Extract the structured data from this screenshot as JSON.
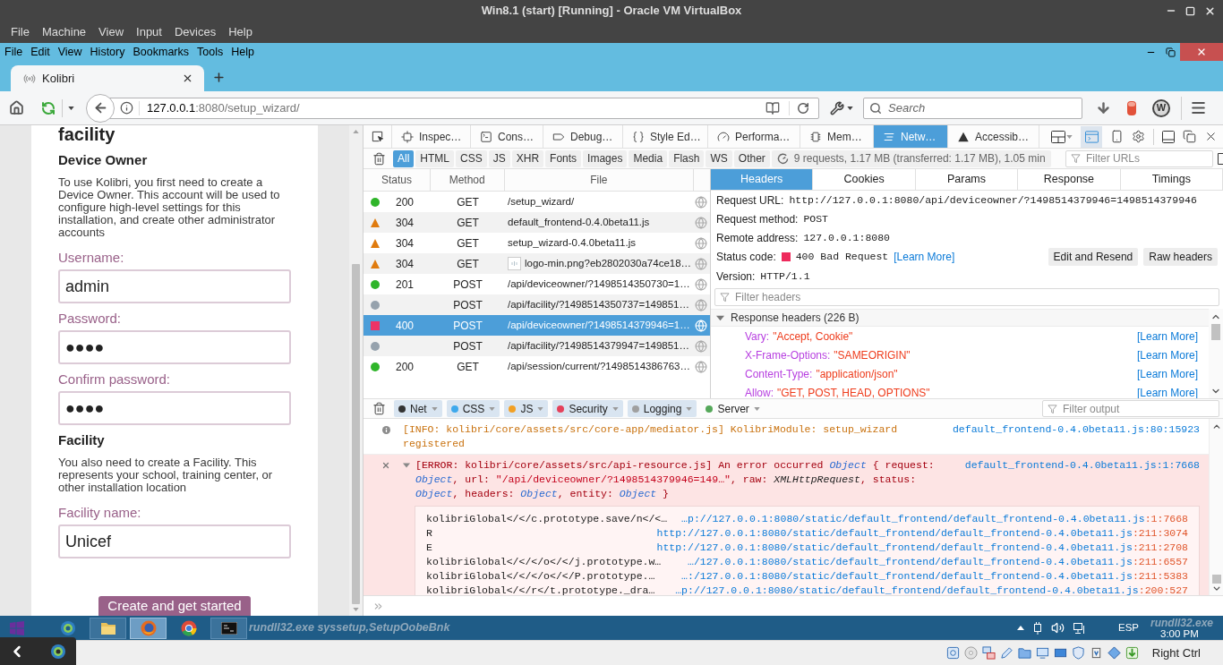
{
  "vm_window": {
    "title": "Win8.1 (start) [Running] - Oracle VM VirtualBox",
    "menu": [
      "File",
      "Machine",
      "View",
      "Input",
      "Devices",
      "Help"
    ]
  },
  "browser": {
    "menu": [
      "File",
      "Edit",
      "View",
      "History",
      "Bookmarks",
      "Tools",
      "Help"
    ],
    "tabs": [
      {
        "title": "Kolibri",
        "selected": true
      }
    ],
    "address": {
      "host": "127.0.0.1",
      "path": ":8080/setup_wizard/"
    },
    "search": {
      "placeholder": "Search"
    },
    "extension_badge": "W"
  },
  "page": {
    "heading": "facility",
    "blocks": [
      {
        "kind": "section_title",
        "text": "Device Owner"
      },
      {
        "kind": "paragraph",
        "text": "To use Kolibri, you first need to create a Device Owner. This account will be used to configure high-level settings for this installation, and create other administrator accounts"
      },
      {
        "kind": "field",
        "label": "Username:",
        "value": "admin"
      },
      {
        "kind": "field",
        "label": "Password:",
        "value": "●●●●"
      },
      {
        "kind": "field",
        "label": "Confirm password:",
        "value": "●●●●"
      },
      {
        "kind": "section_title",
        "text": "Facility"
      },
      {
        "kind": "paragraph",
        "text": "You also need to create a Facility. This represents your school, training center, or other installation location"
      },
      {
        "kind": "field",
        "label": "Facility name:",
        "value": "Unicef"
      }
    ],
    "submit": "Create and get started"
  },
  "devtools": {
    "tools": [
      {
        "kind": "inspector",
        "label": "Inspec…",
        "selected": false
      },
      {
        "kind": "console",
        "label": "Cons…",
        "selected": false
      },
      {
        "kind": "debugger",
        "label": "Debug…",
        "selected": false
      },
      {
        "kind": "style_editor",
        "label": "Style Ed…",
        "selected": false
      },
      {
        "kind": "performance",
        "label": "Performa…",
        "selected": false
      },
      {
        "kind": "memory",
        "label": "Mem…",
        "selected": false
      },
      {
        "kind": "network",
        "label": "Netw…",
        "selected": true
      },
      {
        "kind": "accessibility",
        "label": "Accessib…",
        "selected": false
      }
    ],
    "split_console": true,
    "type_filters": [
      {
        "label": "All",
        "selected": true
      },
      {
        "label": "HTML",
        "selected": false
      },
      {
        "label": "CSS",
        "selected": false
      },
      {
        "label": "JS",
        "selected": false
      },
      {
        "label": "XHR",
        "selected": false
      },
      {
        "label": "Fonts",
        "selected": false
      },
      {
        "label": "Images",
        "selected": false
      },
      {
        "label": "Media",
        "selected": false
      },
      {
        "label": "Flash",
        "selected": false
      },
      {
        "label": "WS",
        "selected": false
      },
      {
        "label": "Other",
        "selected": false
      }
    ],
    "summary": "9 requests, 1.17 MB (transferred: 1.17 MB), 1.05 min",
    "url_filter": {
      "placeholder": "Filter URLs"
    },
    "requests": {
      "columns": [
        "Status",
        "Method",
        "File"
      ],
      "rows": [
        {
          "kind": "dot",
          "color": "#2fb52a",
          "status": "200",
          "method": "GET",
          "file": "/setup_wizard/",
          "thumbnail": false,
          "selected": false
        },
        {
          "kind": "triangle",
          "color": "#e07b0e",
          "status": "304",
          "method": "GET",
          "file": "default_frontend-0.4.0beta11.js",
          "thumbnail": false,
          "selected": false
        },
        {
          "kind": "triangle",
          "color": "#e07b0e",
          "status": "304",
          "method": "GET",
          "file": "setup_wizard-0.4.0beta11.js",
          "thumbnail": false,
          "selected": false
        },
        {
          "kind": "triangle",
          "color": "#e07b0e",
          "status": "304",
          "method": "GET",
          "file": "logo-min.png?eb2802030a74ce18…",
          "thumbnail": true,
          "selected": false
        },
        {
          "kind": "dot",
          "color": "#2fb52a",
          "status": "201",
          "method": "POST",
          "file": "/api/deviceowner/?1498514350730=1…",
          "thumbnail": false,
          "selected": false
        },
        {
          "kind": "dot",
          "color": "#96a2ad",
          "method": "POST",
          "file": "/api/facility/?1498514350737=149851…",
          "thumbnail": false,
          "selected": false
        },
        {
          "kind": "square",
          "color": "#ee3366",
          "status": "400",
          "method": "POST",
          "file": "/api/deviceowner/?1498514379946=1…",
          "thumbnail": false,
          "selected": true
        },
        {
          "kind": "dot",
          "color": "#96a2ad",
          "method": "POST",
          "file": "/api/facility/?1498514379947=149851…",
          "thumbnail": false,
          "selected": false
        },
        {
          "kind": "dot",
          "color": "#2fb52a",
          "status": "200",
          "method": "GET",
          "file": "/api/session/current/?1498514386763…",
          "thumbnail": false,
          "selected": false
        }
      ]
    },
    "details": {
      "tabs": [
        {
          "label": "Headers",
          "selected": true
        },
        {
          "label": "Cookies",
          "selected": false
        },
        {
          "label": "Params",
          "selected": false
        },
        {
          "label": "Response",
          "selected": false
        },
        {
          "label": "Timings",
          "selected": false
        }
      ],
      "summary": [
        {
          "kind": "field",
          "label": "Request URL:",
          "value": "http://127.0.0.1:8080/api/deviceowner/?1498514379946=1498514379946"
        },
        {
          "kind": "field",
          "label": "Request method:",
          "value": "POST"
        },
        {
          "kind": "field",
          "label": "Remote address:",
          "value": "127.0.0.1:8080"
        },
        {
          "kind": "status",
          "label": "Status code:",
          "color": "#ee2a5c",
          "value": "400 Bad Request",
          "link": "[Learn More]"
        },
        {
          "kind": "field",
          "label": "Version:",
          "value": "HTTP/1.1"
        }
      ],
      "buttons": [
        "Edit and Resend",
        "Raw headers"
      ],
      "header_filter": {
        "placeholder": "Filter headers"
      },
      "response_headers": {
        "title": "Response headers (226 B)",
        "expanded": true,
        "items": [
          {
            "name": "Vary:",
            "value": "\"Accept, Cookie\"",
            "link": "[Learn More]"
          },
          {
            "name": "X-Frame-Options:",
            "value": "\"SAMEORIGIN\"",
            "link": "[Learn More]"
          },
          {
            "name": "Content-Type:",
            "value": "\"application/json\"",
            "link": "[Learn More]"
          },
          {
            "name": "Allow:",
            "value": "\"GET, POST, HEAD, OPTIONS\"",
            "link": "[Learn More]"
          }
        ]
      }
    },
    "console": {
      "filters": [
        {
          "label": "Net",
          "color": "#333333",
          "checked": true
        },
        {
          "label": "CSS",
          "color": "#3fa9ec",
          "checked": true
        },
        {
          "label": "JS",
          "color": "#f2a024",
          "checked": true
        },
        {
          "label": "Security",
          "color": "#e5415b",
          "checked": true
        },
        {
          "label": "Logging",
          "color": "#a0a0a0",
          "checked": true
        },
        {
          "label": "Server",
          "color": "#55a85a",
          "checked": false
        }
      ],
      "output_filter": {
        "placeholder": "Filter output"
      },
      "messages": [
        {
          "kind": "info",
          "text": "[INFO: kolibri/core/assets/src/core-app/mediator.js] KolibriModule: setup_wizard registered",
          "location": "default_frontend-0.4.0beta11.js:80:15923"
        },
        {
          "kind": "error",
          "expanded": true,
          "segments": [
            {
              "kind": "text",
              "text": "[ERROR: kolibri/core/assets/src/api-resource.js] An error occurred "
            },
            {
              "kind": "object",
              "text": "Object"
            },
            {
              "kind": "text",
              "text": " { request: "
            },
            {
              "kind": "object",
              "text": "Object"
            },
            {
              "kind": "text",
              "text": ", url: "
            },
            {
              "kind": "string",
              "text": "\"/api/deviceowner/?1498514379946=149…\""
            },
            {
              "kind": "text",
              "text": ", raw: "
            },
            {
              "kind": "class",
              "text": "XMLHttpRequest"
            },
            {
              "kind": "text",
              "text": ", status: "
            },
            {
              "kind": "object",
              "text": "Object"
            },
            {
              "kind": "text",
              "text": ", headers: "
            },
            {
              "kind": "object",
              "text": "Object"
            },
            {
              "kind": "text",
              "text": ", entity: "
            },
            {
              "kind": "object",
              "text": "Object"
            },
            {
              "kind": "text",
              "text": " }"
            }
          ],
          "location": "default_frontend-0.4.0beta11.js:1:7668",
          "stack": [
            {
              "function": "kolibriGlobal</</c.prototype.save/n</<…",
              "url": "…p://127.0.0.1:8080/static/default_frontend/default_frontend-0.4.0beta11.js",
              "position": ":1:7668"
            },
            {
              "function": "R",
              "url": "http://127.0.0.1:8080/static/default_frontend/default_frontend-0.4.0beta11.js",
              "position": ":211:3074"
            },
            {
              "function": "E",
              "url": "http://127.0.0.1:8080/static/default_frontend/default_frontend-0.4.0beta11.js",
              "position": ":211:2708"
            },
            {
              "function": "kolibriGlobal</</</o</</j.prototype.w…",
              "url": "…/127.0.0.1:8080/static/default_frontend/default_frontend-0.4.0beta11.js",
              "position": ":211:6557"
            },
            {
              "function": "kolibriGlobal</</</o</</P.prototype.…",
              "url": "…:/127.0.0.1:8080/static/default_frontend/default_frontend-0.4.0beta11.js",
              "position": ":211:5383"
            },
            {
              "function": "kolibriGlobal</</r</t.prototype._dra…",
              "url": "…p://127.0.0.1:8080/static/default_frontend/default_frontend-0.4.0beta11.js",
              "position": ":200:527"
            }
          ]
        }
      ]
    }
  },
  "taskbar": {
    "apps": [
      {
        "kind": "circle_app",
        "running": false,
        "selected": false
      },
      {
        "kind": "explorer",
        "running": true,
        "selected": false
      },
      {
        "kind": "firefox",
        "running": true,
        "selected": true
      },
      {
        "kind": "chrome",
        "running": false,
        "selected": false
      },
      {
        "kind": "terminal",
        "running": true,
        "selected": false
      }
    ],
    "notice": "rundll32.exe syssetup,SetupOobeBnk",
    "language": "ESP",
    "notice_right": "rundll32.exe",
    "clock": "3:00 PM"
  },
  "vm_status_bar": {
    "host_key": "Right Ctrl"
  }
}
